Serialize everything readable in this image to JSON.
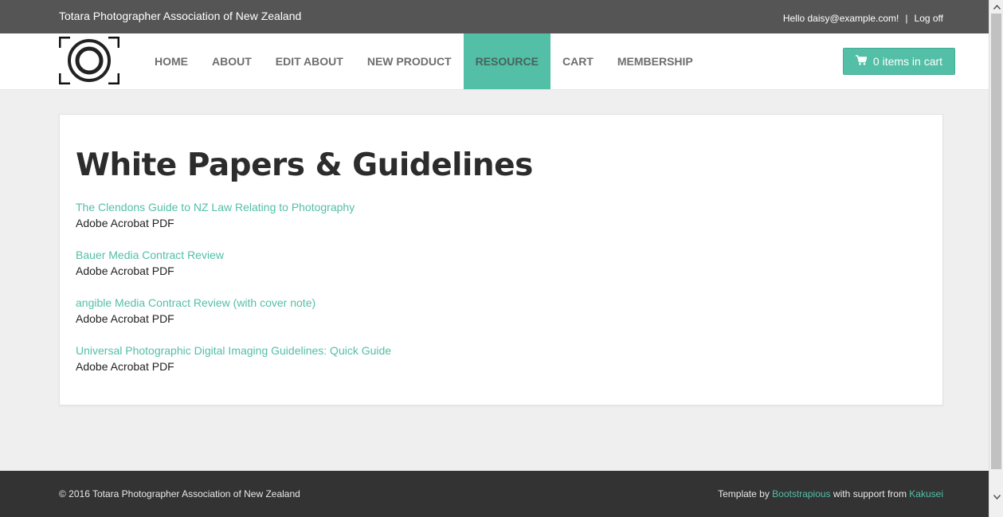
{
  "topbar": {
    "site_name": "Totara Photographer Association of New Zealand",
    "greeting": "Hello daisy@example.com!",
    "separator": "|",
    "logoff_label": "Log off"
  },
  "nav": {
    "logo_icon": "camera-aperture-logo",
    "items": [
      {
        "label": "HOME",
        "active": false
      },
      {
        "label": "ABOUT",
        "active": false
      },
      {
        "label": "EDIT ABOUT",
        "active": false
      },
      {
        "label": "NEW PRODUCT",
        "active": false
      },
      {
        "label": "RESOURCE",
        "active": true
      },
      {
        "label": "CART",
        "active": false
      },
      {
        "label": "MEMBERSHIP",
        "active": false
      }
    ],
    "cart_button": {
      "label": "0 items in cart",
      "icon": "shopping-cart-icon"
    }
  },
  "main": {
    "title": "White Papers & Guidelines",
    "documents": [
      {
        "title": "The Clendons Guide to NZ Law Relating to Photography",
        "type": "Adobe Acrobat PDF"
      },
      {
        "title": "Bauer Media Contract Review",
        "type": "Adobe Acrobat PDF"
      },
      {
        "title": "angible Media Contract Review (with cover note)",
        "type": "Adobe Acrobat PDF"
      },
      {
        "title": "Universal Photographic Digital Imaging Guidelines: Quick Guide",
        "type": "Adobe Acrobat PDF"
      }
    ]
  },
  "footer": {
    "copyright": "© 2016 Totara Photographer Association of New Zealand",
    "template_by": "Template by",
    "template_link": "Bootstrapious",
    "support_from": "with support from",
    "support_link": "Kakusei"
  },
  "colors": {
    "accent": "#52bfa6",
    "topbar": "#555555",
    "footer": "#333333",
    "background": "#efefef"
  }
}
